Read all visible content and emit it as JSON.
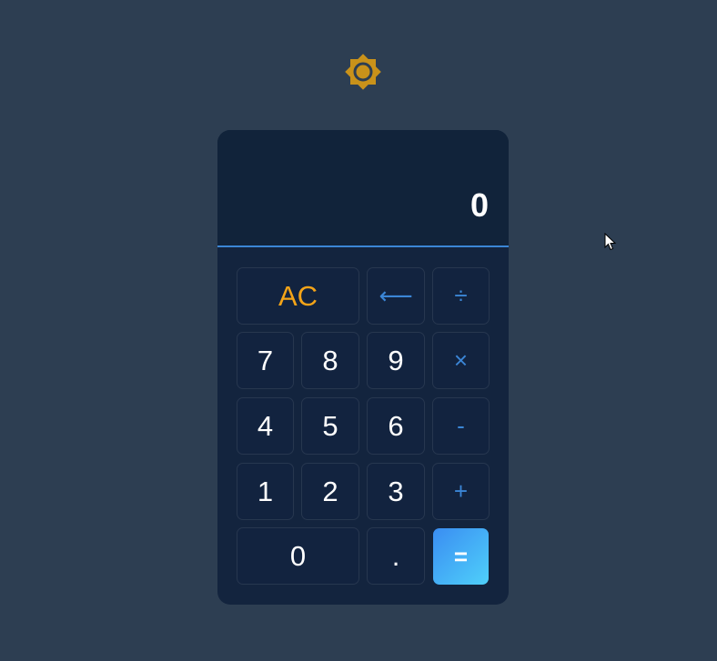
{
  "theme_toggle": {
    "icon": "sun-icon",
    "color": "#d4a017"
  },
  "display": {
    "value": "0"
  },
  "keys": {
    "clear": "AC",
    "backspace": "⟵",
    "divide": "÷",
    "seven": "7",
    "eight": "8",
    "nine": "9",
    "multiply": "×",
    "four": "4",
    "five": "5",
    "six": "6",
    "subtract": "-",
    "one": "1",
    "two": "2",
    "three": "3",
    "add": "+",
    "zero": "0",
    "decimal": ".",
    "equals": "="
  },
  "colors": {
    "background": "#2d3e52",
    "panel": "#13243e",
    "accent": "#3b86d6",
    "clear": "#f4a418"
  }
}
